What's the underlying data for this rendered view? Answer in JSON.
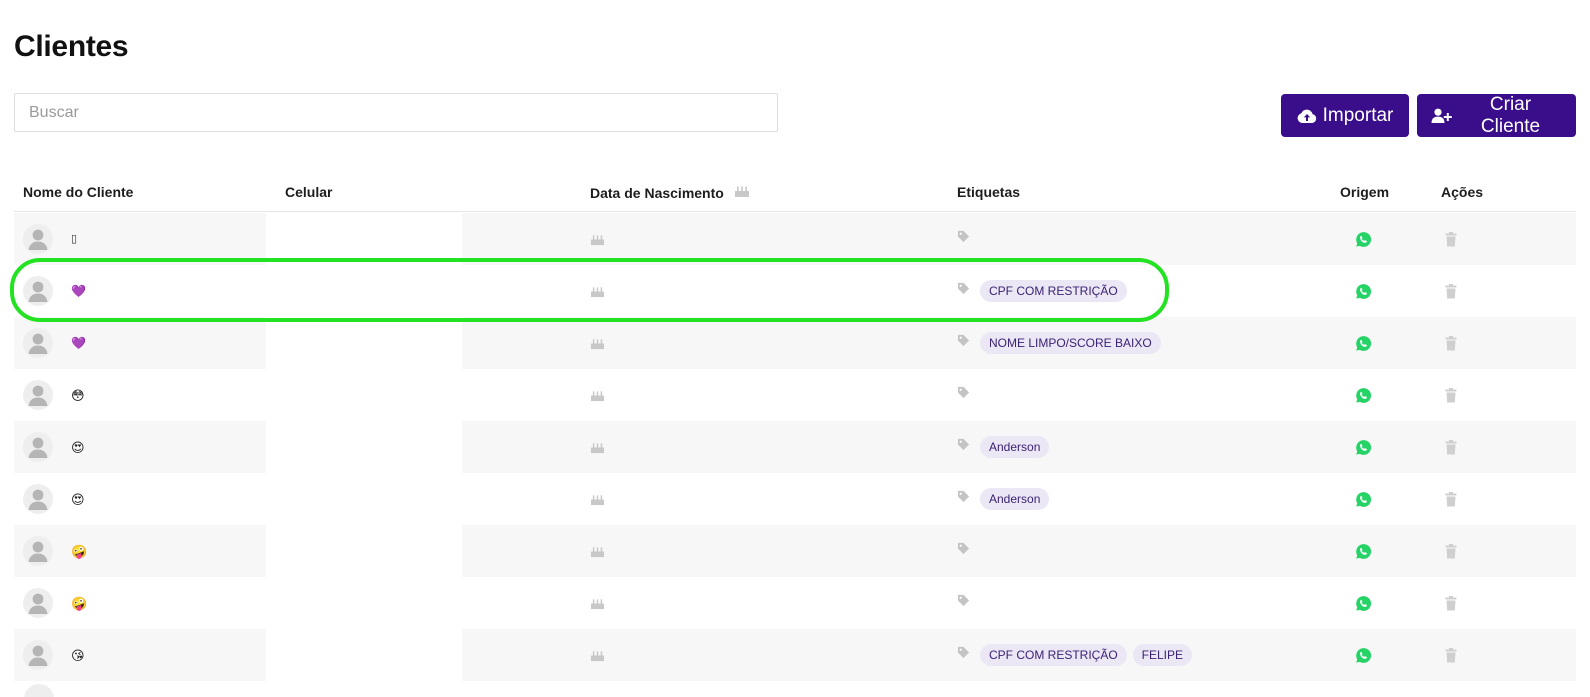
{
  "page": {
    "title": "Clientes"
  },
  "search": {
    "placeholder": "Buscar",
    "value": ""
  },
  "actions": {
    "import_label": "Importar",
    "create_label": "Criar Cliente"
  },
  "table": {
    "headers": {
      "name": "Nome do Cliente",
      "phone": "Celular",
      "birth": "Data de Nascimento",
      "tags": "Etiquetas",
      "origin": "Origem",
      "actions": "Ações"
    },
    "rows": [
      {
        "emoji": "▯",
        "emoji_kind": "box",
        "tags": []
      },
      {
        "emoji": "💜",
        "emoji_kind": "heart",
        "tags": [
          "CPF COM RESTRIÇÃO"
        ]
      },
      {
        "emoji": "💜",
        "emoji_kind": "heart",
        "tags": [
          "NOME LIMPO/SCORE BAIXO"
        ]
      },
      {
        "emoji": "😳",
        "emoji_kind": "face",
        "tags": []
      },
      {
        "emoji": "😍",
        "emoji_kind": "face",
        "tags": [
          "Anderson"
        ]
      },
      {
        "emoji": "😍",
        "emoji_kind": "face",
        "tags": [
          "Anderson"
        ]
      },
      {
        "emoji": "🤪",
        "emoji_kind": "face",
        "tags": []
      },
      {
        "emoji": "🤪",
        "emoji_kind": "face",
        "tags": []
      },
      {
        "emoji": "😘",
        "emoji_kind": "face",
        "tags": [
          "CPF COM RESTRIÇÃO",
          "FELIPE"
        ]
      }
    ]
  },
  "colors": {
    "primary": "#3a0d8a",
    "tag_bg": "#ebe7f4",
    "tag_text": "#3b2276",
    "whatsapp": "#25d366",
    "highlight": "#22e222"
  },
  "icons": {
    "import": "cloud-upload-icon",
    "create": "user-plus-icon",
    "birth": "cake-icon",
    "tag": "tag-icon",
    "origin": "whatsapp-icon",
    "delete": "trash-icon",
    "avatar": "user-avatar-icon"
  }
}
